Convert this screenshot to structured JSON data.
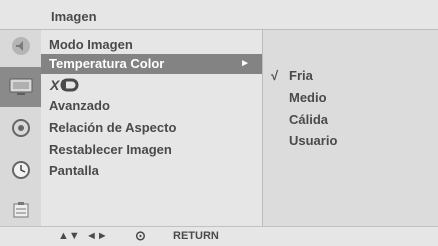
{
  "menu": {
    "title": "Imagen",
    "items": [
      {
        "label": "Modo Imagen"
      },
      {
        "label": "Temperatura Color",
        "arrow": "►"
      },
      {
        "label": "XD"
      },
      {
        "label": "Avanzado"
      },
      {
        "label": "Relación de Aspecto"
      },
      {
        "label": "Restablecer Imagen"
      },
      {
        "label": "Pantalla"
      }
    ]
  },
  "submenu": {
    "checkmark": "√",
    "options": [
      {
        "label": "Fria"
      },
      {
        "label": "Medio"
      },
      {
        "label": "Cálida"
      },
      {
        "label": "Usuario"
      }
    ]
  },
  "footer": {
    "nav_updown": "▲▼",
    "nav_leftright": "◄►",
    "ok_symbol": "⊙",
    "return_label": "RETURN"
  },
  "sidebar_icons": [
    "audio-icon",
    "picture-icon",
    "option-icon",
    "time-icon",
    "setup-icon"
  ]
}
